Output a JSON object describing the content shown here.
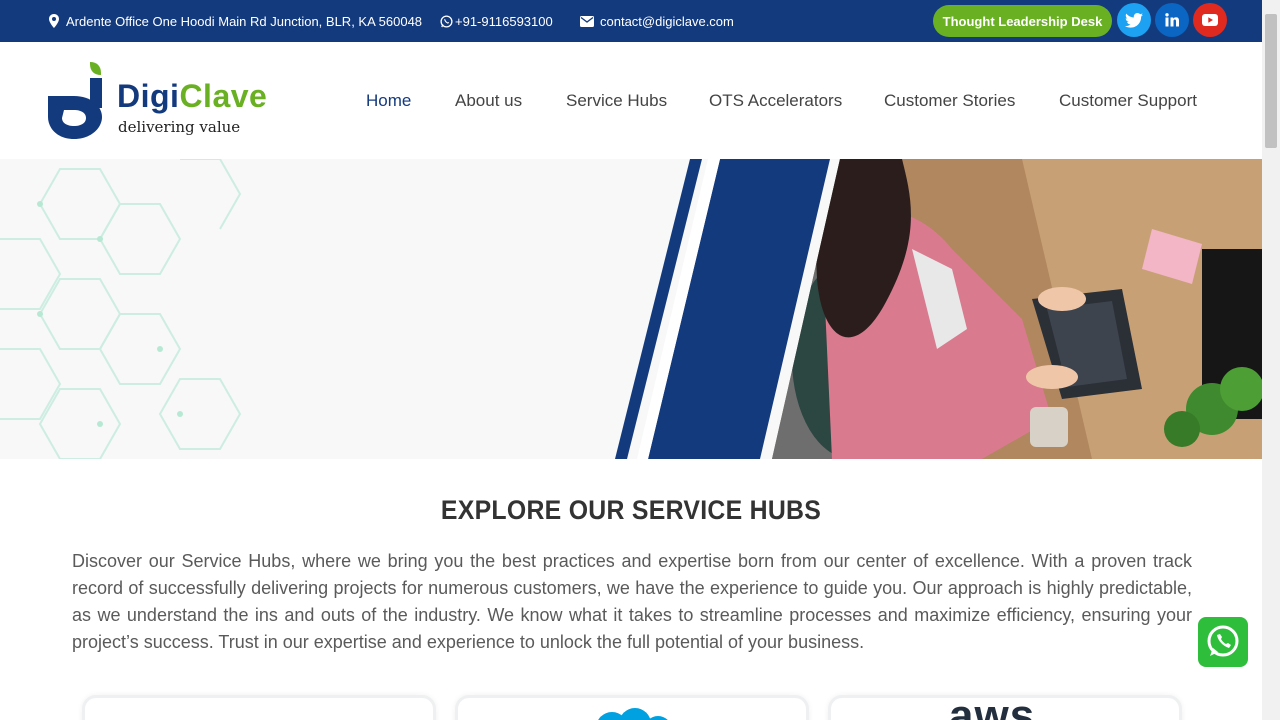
{
  "topbar": {
    "address": "Ardente Office One Hoodi Main Rd Junction, BLR, KA 560048",
    "phone": "+91-9116593100",
    "email": "contact@digiclave.com",
    "cta_label": "Thought Leadership Desk",
    "social": [
      {
        "name": "twitter-icon",
        "color": "#1da1f2"
      },
      {
        "name": "linkedin-icon",
        "color": "#0a66c2"
      },
      {
        "name": "youtube-icon",
        "color": "#e02a20"
      }
    ]
  },
  "brand": {
    "name_part1": "Digi",
    "name_part2": "Clave",
    "tagline": "delivering value",
    "primary_color": "#143a7e",
    "accent_color": "#6ab023"
  },
  "nav": {
    "items": [
      "Home",
      "About us",
      "Service Hubs",
      "OTS Accelerators",
      "Customer Stories",
      "Customer Support"
    ],
    "active": "Home"
  },
  "section": {
    "title": "EXPLORE OUR SERVICE HUBS",
    "body": "Discover our Service Hubs, where we bring you the best practices and expertise born from our center of excellence. With a proven track record of successfully delivering projects for numerous customers, we have the experience to guide you. Our approach is highly predictable, as we understand the ins and outs of the industry. We know what it takes to streamline processes and maximize efficiency, ensuring your project’s success. Trust in our expertise and experience to unlock the full potential of your business."
  },
  "cards": {
    "logos": [
      "blank-logo",
      "salesforce-cloud-icon",
      "aws-logo"
    ],
    "aws_text": "aws"
  },
  "widgets": {
    "whatsapp_icon": "whatsapp-icon"
  }
}
